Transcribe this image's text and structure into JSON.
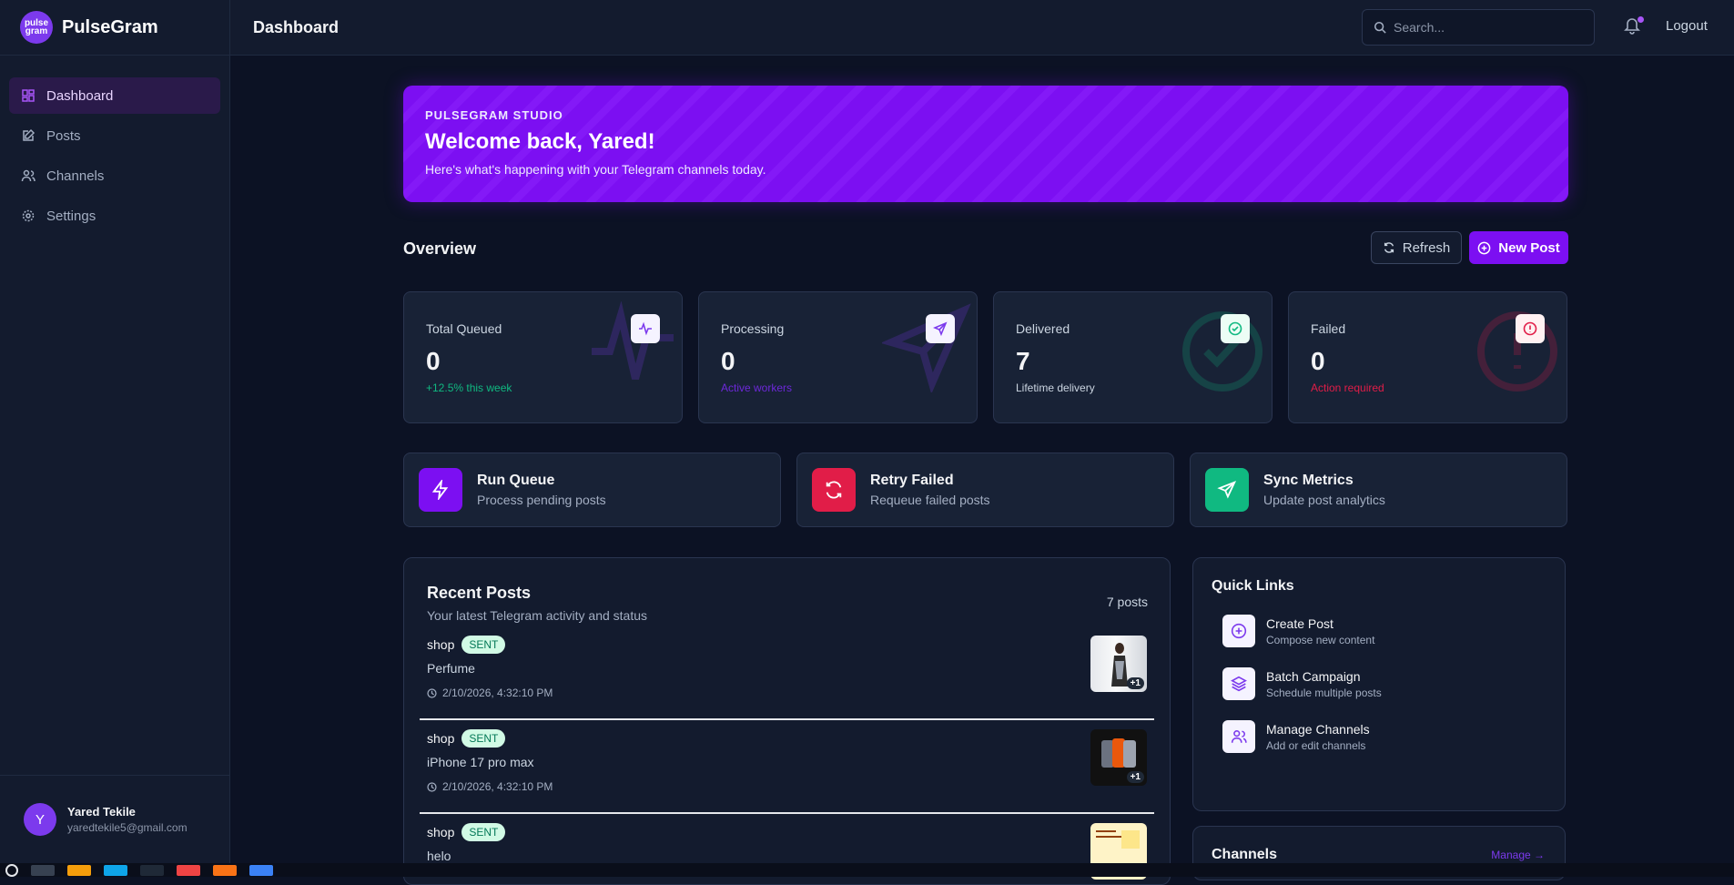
{
  "brand": {
    "name": "PulseGram",
    "logo_text": "pulse gram"
  },
  "sidebar": {
    "items": [
      {
        "label": "Dashboard",
        "icon": "dashboard-icon",
        "active": true
      },
      {
        "label": "Posts",
        "icon": "edit-icon"
      },
      {
        "label": "Channels",
        "icon": "users-icon"
      },
      {
        "label": "Settings",
        "icon": "gear-icon"
      }
    ],
    "user": {
      "initial": "Y",
      "name": "Yared Tekile",
      "email": "yaredtekile5@gmail.com"
    }
  },
  "header": {
    "title": "Dashboard",
    "search_placeholder": "Search...",
    "logout": "Logout"
  },
  "hero": {
    "kicker": "PULSEGRAM STUDIO",
    "title": "Welcome back, Yared!",
    "subtitle": "Here's what's happening with your Telegram channels today."
  },
  "overview": {
    "title": "Overview",
    "refresh": "Refresh",
    "new_post": "New Post"
  },
  "stats": [
    {
      "label": "Total Queued",
      "value": "0",
      "note": "+12.5% this week",
      "note_color": "#10b981",
      "icon": "activity-icon"
    },
    {
      "label": "Processing",
      "value": "0",
      "note": "Active workers",
      "note_color": "#6d28d9",
      "icon": "send-icon"
    },
    {
      "label": "Delivered",
      "value": "7",
      "note": "Lifetime delivery",
      "note_color": "#cbd5e1",
      "icon": "check-circle-icon"
    },
    {
      "label": "Failed",
      "value": "0",
      "note": "Action required",
      "note_color": "#e11d48",
      "icon": "alert-circle-icon"
    }
  ],
  "actions": [
    {
      "title": "Run Queue",
      "subtitle": "Process pending posts",
      "color": "#7c0ff2",
      "icon": "bolt-icon"
    },
    {
      "title": "Retry Failed",
      "subtitle": "Requeue failed posts",
      "color": "#e11d48",
      "icon": "refresh-icon"
    },
    {
      "title": "Sync Metrics",
      "subtitle": "Update post analytics",
      "color": "#10b981",
      "icon": "send-icon"
    }
  ],
  "recent": {
    "title": "Recent Posts",
    "subtitle": "Your latest Telegram activity and status",
    "count": "7 posts",
    "posts": [
      {
        "channel": "shop",
        "status": "SENT",
        "text": "Perfume",
        "time": "2/10/2026, 4:32:10 PM",
        "extra": "+1"
      },
      {
        "channel": "shop",
        "status": "SENT",
        "text": "iPhone 17 pro max",
        "time": "2/10/2026, 4:32:10 PM",
        "extra": "+1"
      },
      {
        "channel": "shop",
        "status": "SENT",
        "text": "helo",
        "time": "",
        "extra": ""
      }
    ]
  },
  "quick_links": {
    "title": "Quick Links",
    "items": [
      {
        "name": "Create Post",
        "desc": "Compose new content",
        "icon": "plus-circle-icon"
      },
      {
        "name": "Batch Campaign",
        "desc": "Schedule multiple posts",
        "icon": "layers-icon"
      },
      {
        "name": "Manage Channels",
        "desc": "Add or edit channels",
        "icon": "users-icon"
      }
    ]
  },
  "channels": {
    "title": "Channels",
    "manage": "Manage →"
  }
}
